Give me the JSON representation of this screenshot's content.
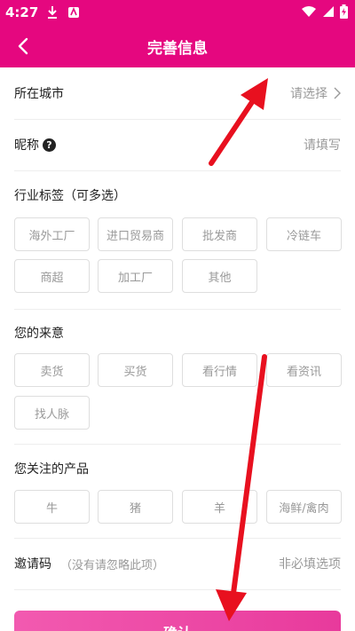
{
  "status": {
    "time": "4:27"
  },
  "nav": {
    "title": "完善信息"
  },
  "city": {
    "label": "所在城市",
    "value": "请选择"
  },
  "nickname": {
    "label": "昵称",
    "placeholder": "请填写"
  },
  "industry": {
    "title": "行业标签（可多选）",
    "tags": [
      "海外工厂",
      "进口贸易商",
      "批发商",
      "冷链车",
      "商超",
      "加工厂",
      "其他"
    ]
  },
  "purpose": {
    "title": "您的来意",
    "tags": [
      "卖货",
      "买货",
      "看行情",
      "看资讯",
      "找人脉"
    ]
  },
  "products": {
    "title": "您关注的产品",
    "tags": [
      "牛",
      "猪",
      "羊",
      "海鲜/禽肉"
    ]
  },
  "invite": {
    "label": "邀请码",
    "hint": "（没有请忽略此项）",
    "placeholder": "非必填选项"
  },
  "confirm": {
    "label": "确认"
  },
  "colors": {
    "brand": "#e5077f",
    "arrow": "#e8101f"
  }
}
